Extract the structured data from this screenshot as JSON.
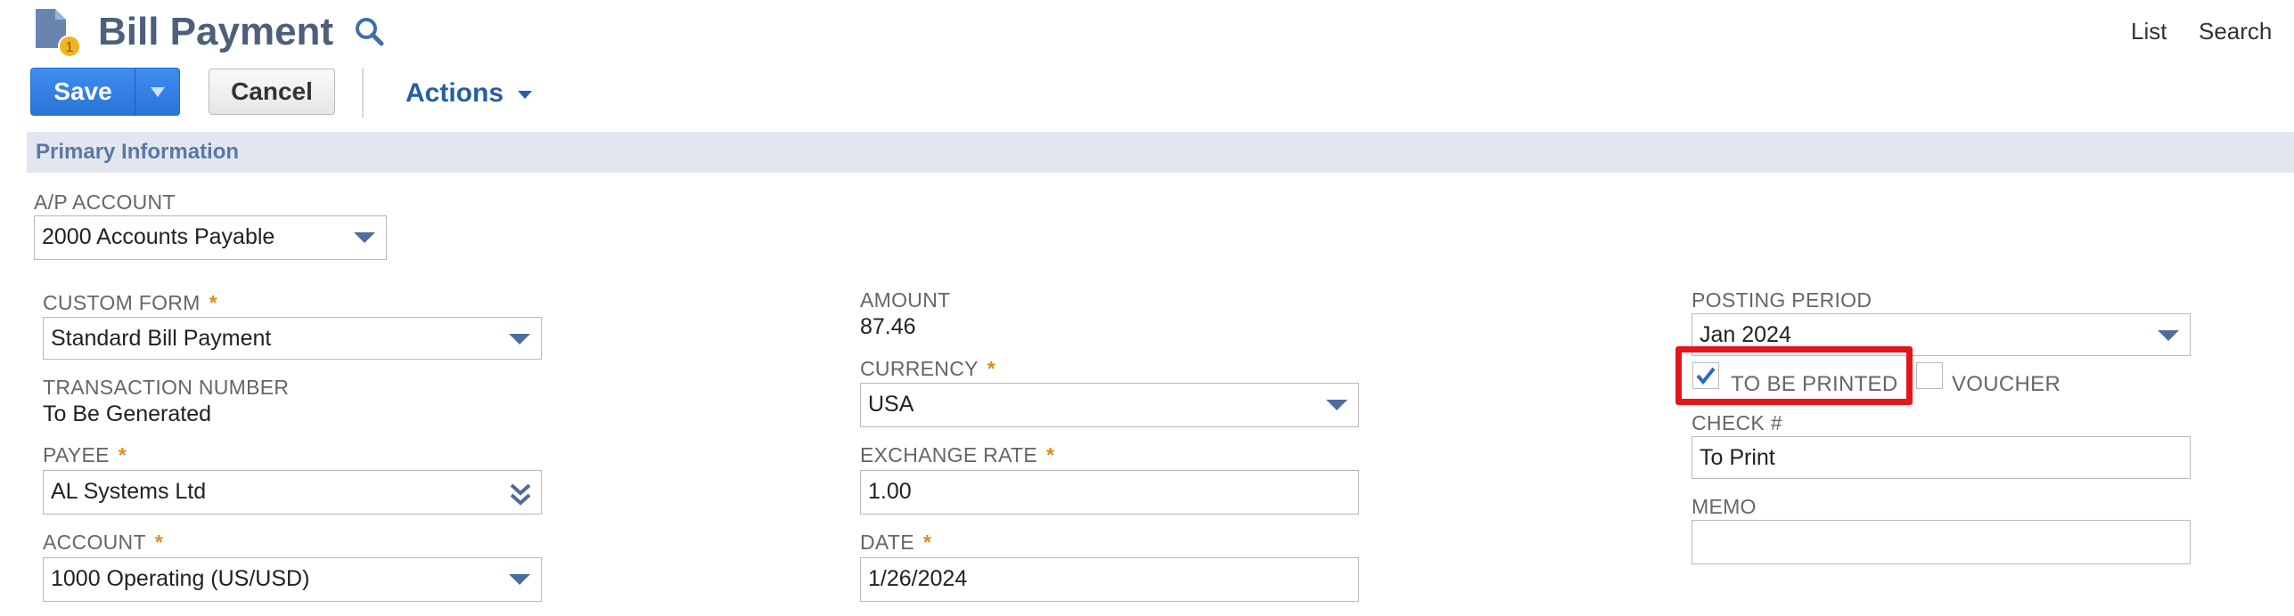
{
  "header": {
    "title": "Bill Payment",
    "links": [
      "List",
      "Search"
    ],
    "icon_badge": "1"
  },
  "toolbar": {
    "save_label": "Save",
    "cancel_label": "Cancel",
    "actions_label": "Actions"
  },
  "section": {
    "title": "Primary Information"
  },
  "fields": {
    "ap_account": {
      "label": "A/P ACCOUNT",
      "value": "2000 Accounts Payable"
    },
    "custom_form": {
      "label": "CUSTOM FORM",
      "required": "*",
      "value": "Standard Bill Payment"
    },
    "transaction_number": {
      "label": "TRANSACTION NUMBER",
      "value": "To Be Generated"
    },
    "payee": {
      "label": "PAYEE",
      "required": "*",
      "value": "AL Systems Ltd"
    },
    "account": {
      "label": "ACCOUNT",
      "required": "*",
      "value": "1000 Operating (US/USD)"
    },
    "amount": {
      "label": "AMOUNT",
      "value": "87.46"
    },
    "currency": {
      "label": "CURRENCY",
      "required": "*",
      "value": "USA"
    },
    "exchange_rate": {
      "label": "EXCHANGE RATE",
      "required": "*",
      "value": "1.00"
    },
    "date": {
      "label": "DATE",
      "required": "*",
      "value": "1/26/2024"
    },
    "posting_period": {
      "label": "POSTING PERIOD",
      "value": "Jan 2024"
    },
    "to_be_printed": {
      "label": "TO BE PRINTED",
      "checked": true
    },
    "voucher": {
      "label": "VOUCHER",
      "checked": false
    },
    "check_number": {
      "label": "CHECK #",
      "value": "To Print"
    },
    "memo": {
      "label": "MEMO",
      "value": ""
    }
  },
  "colors": {
    "accent_blue": "#2a74d6",
    "title_slate": "#4d5f7a",
    "required_orange": "#e08a1e",
    "highlight_red": "#e4161d",
    "section_bg": "#e1e6ef"
  }
}
